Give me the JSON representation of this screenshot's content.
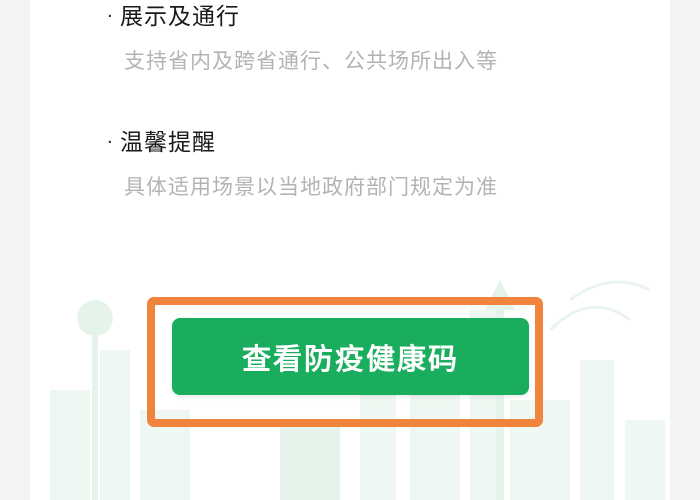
{
  "sections": [
    {
      "title": "展示及通行",
      "description": "支持省内及跨省通行、公共场所出入等"
    },
    {
      "title": "温馨提醒",
      "description": "具体适用场景以当地政府部门规定为准"
    }
  ],
  "bullet": "·",
  "action": {
    "label": "查看防疫健康码"
  },
  "colors": {
    "button": "#1aad5d",
    "highlight_box": "#f0843c",
    "page_bg": "#f2f3f5",
    "card_bg": "#ffffff",
    "description_text": "#b3b3b3"
  }
}
